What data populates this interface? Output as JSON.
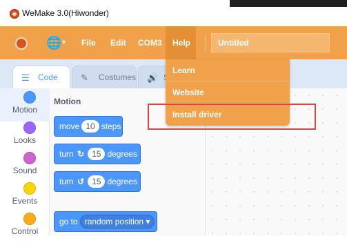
{
  "window": {
    "title": "WeMake 3.0(Hiwonder)"
  },
  "menubar": {
    "items": [
      {
        "label": "File"
      },
      {
        "label": "Edit"
      },
      {
        "label": "COM3"
      },
      {
        "label": "Help"
      }
    ],
    "project_title": "Untitled",
    "language_icon": "globe-icon",
    "logo_icon": "hiwonder-logo-icon"
  },
  "help_menu": {
    "items": [
      {
        "label": "Learn"
      },
      {
        "label": "Website"
      },
      {
        "label": "Install driver"
      }
    ],
    "highlighted_item": "Install driver"
  },
  "tabs": [
    {
      "label": "Code",
      "icon": "code-icon",
      "selected": true
    },
    {
      "label": "Costumes",
      "icon": "brush-icon",
      "selected": false
    },
    {
      "label": "S",
      "icon": "speaker-icon",
      "selected": false
    }
  ],
  "categories": [
    {
      "label": "Motion",
      "color": "#4c97ff"
    },
    {
      "label": "Looks",
      "color": "#9966ff"
    },
    {
      "label": "Sound",
      "color": "#cf63cf"
    },
    {
      "label": "Events",
      "color": "#ffd500"
    },
    {
      "label": "Control",
      "color": "#ffab19"
    }
  ],
  "palette": {
    "section_title": "Motion",
    "blocks": {
      "move": {
        "prefix": "move",
        "value": "10",
        "suffix": "steps"
      },
      "turn_right": {
        "prefix": "turn",
        "symbol": "↻",
        "value": "15",
        "suffix": "degrees"
      },
      "turn_left": {
        "prefix": "turn",
        "symbol": "↺",
        "value": "15",
        "suffix": "degrees"
      },
      "go_to": {
        "prefix": "go to",
        "option": "random position ▾"
      }
    }
  },
  "colors": {
    "menubar": "#f0a14a",
    "block": "#4c97ff",
    "highlight": "#e0443a"
  }
}
